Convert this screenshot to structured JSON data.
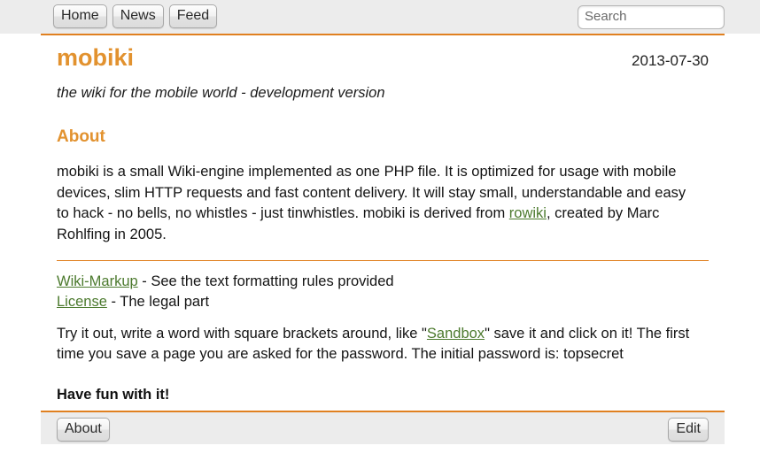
{
  "topbar": {
    "nav_items": [
      {
        "label": "Home",
        "name": "nav-home"
      },
      {
        "label": "News",
        "name": "nav-news"
      },
      {
        "label": "Feed",
        "name": "nav-feed"
      }
    ],
    "search": {
      "value": "",
      "placeholder": "Search",
      "icon": "search-icon"
    }
  },
  "header": {
    "site_title": "mobiki",
    "date": "2013-07-30",
    "tagline": "the wiki for the mobile world - development version"
  },
  "main": {
    "section_title": "About",
    "intro": {
      "part1": "mobiki is a small Wiki-engine implemented as one PHP file. It is optimized for usage with mobile devices, slim HTTP requests and fast content delivery. It will stay small, understandable and easy to hack - no bells, no whistles - just tinwhistles. mobiki is derived from ",
      "link_rowiki": "rowiki",
      "part2": ", created by Marc Rohlfing in 2005."
    },
    "links": [
      {
        "link": "Wiki-Markup",
        "desc": " - See the text formatting rules provided"
      },
      {
        "link": "License",
        "desc": " - The legal part"
      }
    ],
    "tryout": {
      "part1": "Try it out, write a word with square brackets around, like \"",
      "link_sandbox": "Sandbox",
      "part2": "\" save it and click on it! The first time you save a page you are asked for the password. The initial password is: topsecret"
    },
    "closing": "Have fun with it!"
  },
  "footer": {
    "about_label": "About",
    "edit_label": "Edit"
  },
  "colors": {
    "accent": "#e08020",
    "title": "#e2922f",
    "link": "#4c7a2e",
    "bar_bg": "#ececec",
    "page_bg": "#ffffff"
  }
}
